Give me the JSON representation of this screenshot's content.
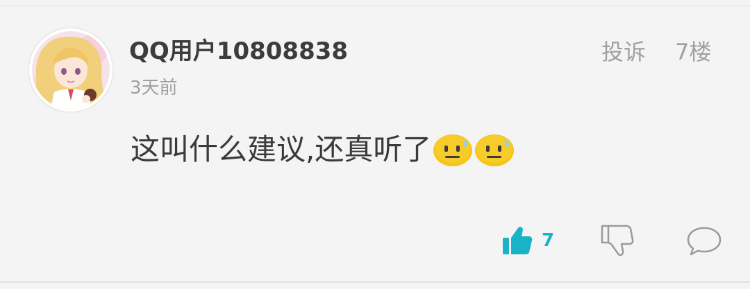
{
  "post": {
    "username": "QQ用户10808838",
    "time": "3天前",
    "report_label": "投诉",
    "floor_label": "7楼",
    "comment_text": "这叫什么建议,还真听了",
    "emojis": [
      "sweat-face-emoji",
      "sweat-face-emoji"
    ]
  },
  "actions": {
    "like_icon": "thumbs-up-icon",
    "like_count": "7",
    "dislike_icon": "thumbs-down-icon",
    "reply_icon": "speech-bubble-icon"
  },
  "colors": {
    "background": "#f4f4f4",
    "username": "#3c3c3c",
    "muted": "#a0a0a0",
    "accent": "#19b3c8",
    "emoji": "#f5c518"
  }
}
